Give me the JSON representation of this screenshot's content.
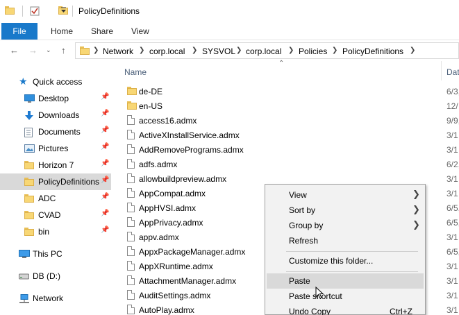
{
  "window": {
    "title": "PolicyDefinitions"
  },
  "ribbon": {
    "tabs": [
      "File",
      "Home",
      "Share",
      "View"
    ]
  },
  "address": {
    "breadcrumbs": [
      "Network",
      "corp.local",
      "SYSVOL",
      "corp.local",
      "Policies",
      "PolicyDefinitions"
    ]
  },
  "navpane": {
    "quick_access": "Quick access",
    "items": [
      {
        "label": "Desktop",
        "icon": "desktop-icon",
        "pinned": true
      },
      {
        "label": "Downloads",
        "icon": "download-icon",
        "pinned": true
      },
      {
        "label": "Documents",
        "icon": "documents-icon",
        "pinned": true
      },
      {
        "label": "Pictures",
        "icon": "pictures-icon",
        "pinned": true
      },
      {
        "label": "Horizon 7",
        "icon": "folder-icon",
        "pinned": true
      },
      {
        "label": "PolicyDefinitions",
        "icon": "folder-icon",
        "pinned": true
      },
      {
        "label": "ADC",
        "icon": "folder-icon",
        "pinned": true
      },
      {
        "label": "CVAD",
        "icon": "folder-icon",
        "pinned": true
      },
      {
        "label": "bin",
        "icon": "folder-icon",
        "pinned": true
      }
    ],
    "roots": [
      "This PC",
      "DB (D:)",
      "Network"
    ]
  },
  "filelist": {
    "columns": [
      "Name",
      "Dat"
    ],
    "rows": [
      {
        "name": "de-DE",
        "type": "folder",
        "date": "6/3,"
      },
      {
        "name": "en-US",
        "type": "folder",
        "date": "12/"
      },
      {
        "name": "access16.admx",
        "type": "file",
        "date": "9/9,"
      },
      {
        "name": "ActiveXInstallService.admx",
        "type": "file",
        "date": "3/1"
      },
      {
        "name": "AddRemovePrograms.admx",
        "type": "file",
        "date": "3/1"
      },
      {
        "name": "adfs.admx",
        "type": "file",
        "date": "6/2,"
      },
      {
        "name": "allowbuildpreview.admx",
        "type": "file",
        "date": "3/1"
      },
      {
        "name": "AppCompat.admx",
        "type": "file",
        "date": "3/1"
      },
      {
        "name": "AppHVSI.admx",
        "type": "file",
        "date": "6/5,"
      },
      {
        "name": "AppPrivacy.admx",
        "type": "file",
        "date": "6/5,"
      },
      {
        "name": "appv.admx",
        "type": "file",
        "date": "3/1"
      },
      {
        "name": "AppxPackageManager.admx",
        "type": "file",
        "date": "6/5,"
      },
      {
        "name": "AppXRuntime.admx",
        "type": "file",
        "date": "3/1"
      },
      {
        "name": "AttachmentManager.admx",
        "type": "file",
        "date": "3/1"
      },
      {
        "name": "AuditSettings.admx",
        "type": "file",
        "date": "3/1"
      },
      {
        "name": "AutoPlay.admx",
        "type": "file",
        "date": "3/1"
      }
    ]
  },
  "context_menu": {
    "items": [
      {
        "label": "View",
        "submenu": true
      },
      {
        "label": "Sort by",
        "submenu": true
      },
      {
        "label": "Group by",
        "submenu": true
      },
      {
        "label": "Refresh",
        "submenu": false
      },
      {
        "label": "Customize this folder...",
        "submenu": false
      },
      {
        "label": "Paste",
        "submenu": false,
        "highlighted": true
      },
      {
        "label": "Paste shortcut",
        "submenu": false
      },
      {
        "label": "Undo Copy",
        "shortcut": "Ctrl+Z"
      }
    ]
  },
  "colors": {
    "accent": "#1979ca",
    "folder": "#f8d775",
    "selection": "#d9d9d9",
    "menu_bg": "#f2f2f2"
  }
}
